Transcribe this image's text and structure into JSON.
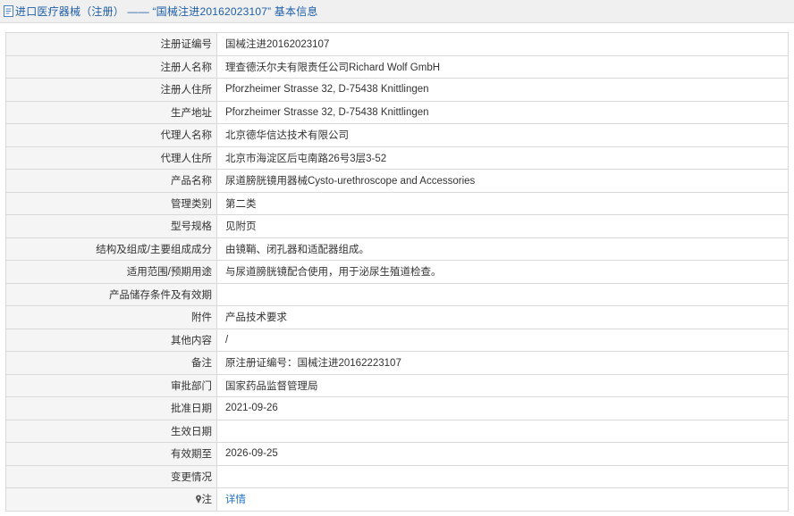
{
  "header": {
    "title": "进口医疗器械（注册） —— “国械注进20162023107” 基本信息"
  },
  "rows": [
    {
      "label": "注册证编号",
      "value": "国械注进20162023107"
    },
    {
      "label": "注册人名称",
      "value": "理查德沃尔夫有限责任公司Richard Wolf GmbH"
    },
    {
      "label": "注册人住所",
      "value": "Pforzheimer Strasse 32, D-75438 Knittlingen"
    },
    {
      "label": "生产地址",
      "value": "Pforzheimer Strasse 32, D-75438 Knittlingen"
    },
    {
      "label": "代理人名称",
      "value": "北京德华信达技术有限公司"
    },
    {
      "label": "代理人住所",
      "value": "北京市海淀区后屯南路26号3层3-52"
    },
    {
      "label": "产品名称",
      "value": "尿道膀胱镜用器械Cysto-urethroscope and Accessories"
    },
    {
      "label": "管理类别",
      "value": "第二类"
    },
    {
      "label": "型号规格",
      "value": "见附页"
    },
    {
      "label": "结构及组成/主要组成成分",
      "value": "由镜鞘、闭孔器和适配器组成。"
    },
    {
      "label": "适用范围/预期用途",
      "value": "与尿道膀胱镜配合使用，用于泌尿生殖道检查。"
    },
    {
      "label": "产品储存条件及有效期",
      "value": ""
    },
    {
      "label": "附件",
      "value": "产品技术要求"
    },
    {
      "label": "其他内容",
      "value": "/"
    },
    {
      "label": "备注",
      "value": "原注册证编号：国械注进20162223107"
    },
    {
      "label": "审批部门",
      "value": "国家药品监督管理局"
    },
    {
      "label": "批准日期",
      "value": "2021-09-26"
    },
    {
      "label": "生效日期",
      "value": ""
    },
    {
      "label": "有效期至",
      "value": "2026-09-25"
    },
    {
      "label": "变更情况",
      "value": ""
    }
  ],
  "note_row": {
    "label": "注",
    "link_text": "详情"
  },
  "icons": {
    "title": "document-icon",
    "note": "pin-icon"
  },
  "colors": {
    "title_text": "#1f5ea8",
    "link": "#1f6fc5",
    "label_bg": "#f5f5f5",
    "border": "#d9d9d9"
  }
}
